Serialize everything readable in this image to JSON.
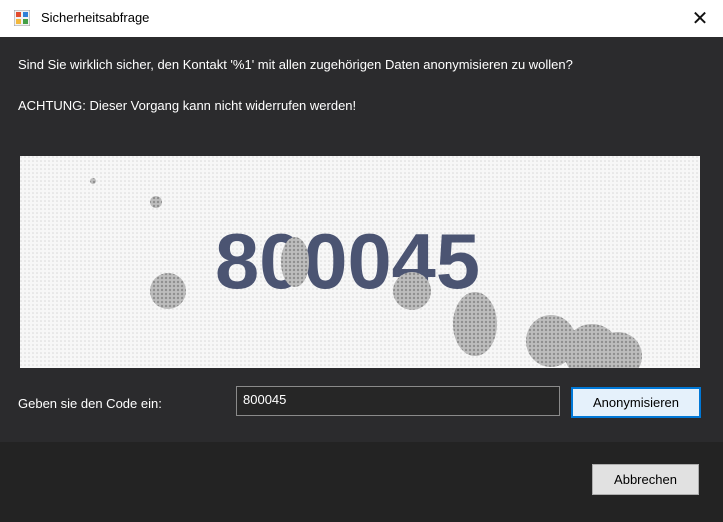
{
  "window": {
    "title": "Sicherheitsabfrage",
    "close_glyph": "✕"
  },
  "message": {
    "question": "Sind Sie wirklich sicher, den Kontakt '%1' mit allen zugehörigen Daten anonymisieren zu wollen?",
    "warning": "ACHTUNG: Dieser Vorgang kann nicht widerrufen werden!"
  },
  "captcha": {
    "code": "800045",
    "text_color": "#4b5472",
    "noise_color": "#a9a9a9"
  },
  "form": {
    "code_label": "Geben sie den Code ein:",
    "code_value": "800045",
    "submit_label": "Anonymisieren"
  },
  "footer": {
    "cancel_label": "Abbrechen"
  },
  "icons": [
    "app-window-icon",
    "close-icon"
  ]
}
